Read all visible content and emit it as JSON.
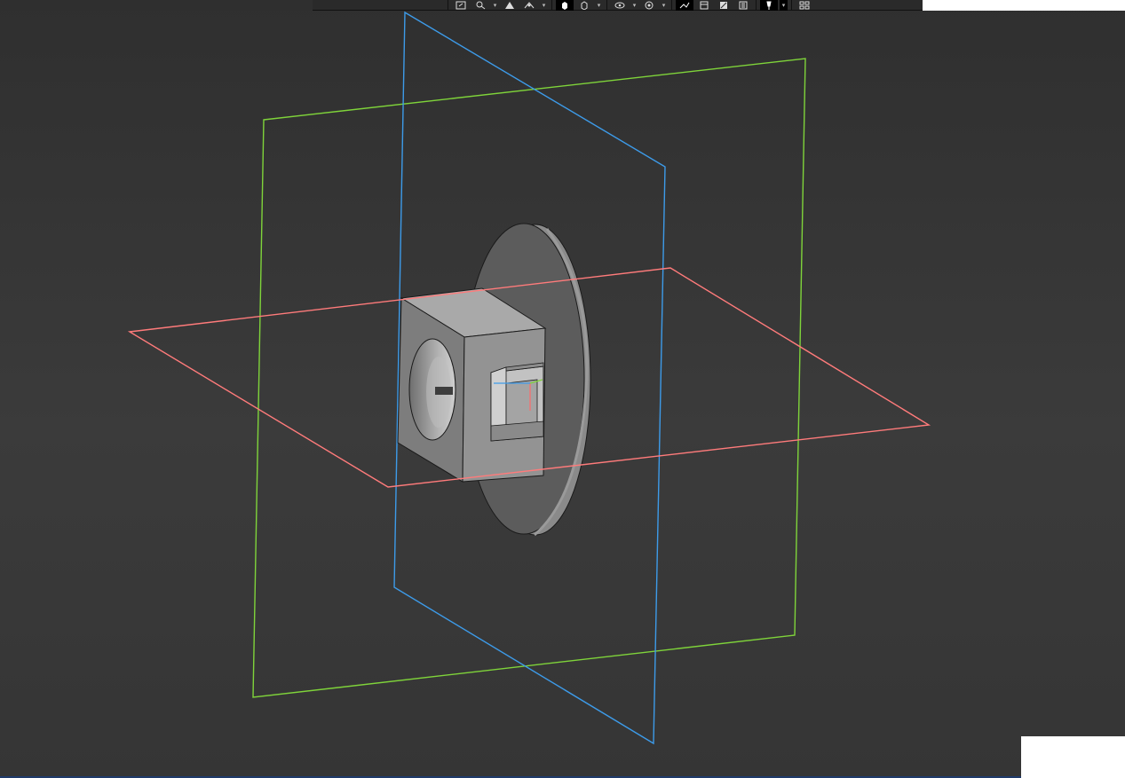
{
  "app": {
    "view": "3D viewport",
    "background_top": "#2f2f2f",
    "background_bottom": "#353535"
  },
  "colors": {
    "front_plane": "#7fd43a",
    "right_plane": "#3d9be9",
    "top_plane": "#ff7b7b",
    "model_face": "#8f8f8f",
    "model_edge": "#1a1a1a"
  },
  "toolbar": {
    "buttons": [
      {
        "icon": "zoom-to-fit-icon",
        "dropdown": false
      },
      {
        "icon": "zoom-to-area-icon",
        "dropdown": true
      },
      {
        "icon": "previous-view-icon",
        "dropdown": false
      },
      {
        "icon": "section-view-icon",
        "dropdown": true
      },
      {
        "icon": "view-orientation-icon",
        "dropdown": false,
        "active": true
      },
      {
        "icon": "display-style-icon",
        "dropdown": true
      },
      {
        "icon": "hide-show-items-icon",
        "dropdown": true
      },
      {
        "icon": "edit-appearance-icon",
        "dropdown": true
      },
      {
        "icon": "apply-scene-icon",
        "dropdown": false,
        "active": true
      },
      {
        "icon": "view-settings-icon",
        "dropdown": false
      },
      {
        "icon": "realview-icon",
        "dropdown": false
      },
      {
        "icon": "shadows-icon",
        "dropdown": false
      },
      {
        "icon": "pin-icon",
        "dropdown": true,
        "active": true
      },
      {
        "icon": "view-layout-icon",
        "dropdown": false
      }
    ]
  }
}
